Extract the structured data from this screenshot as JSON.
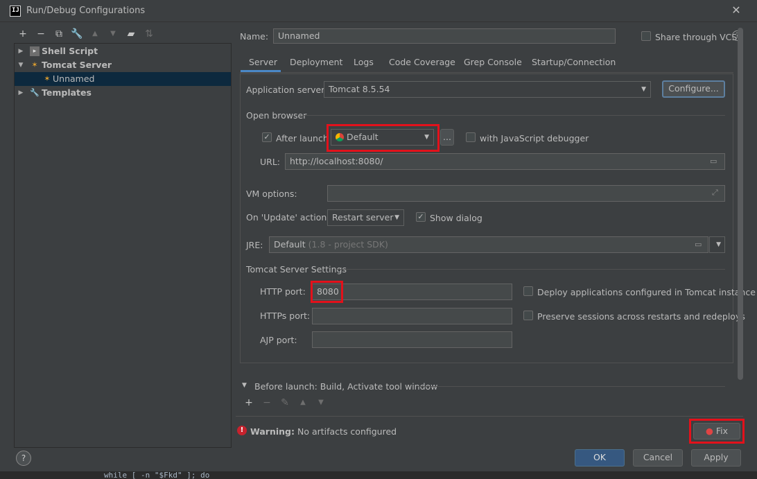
{
  "window": {
    "title": "Run/Debug Configurations",
    "app_icon_text": "IJ"
  },
  "toolbar": {
    "icons": [
      "add-icon",
      "remove-icon",
      "copy-icon",
      "wrench-icon",
      "move-up-icon",
      "move-down-icon",
      "folder-icon",
      "sort-icon"
    ]
  },
  "tree": {
    "items": [
      {
        "label": "Shell Script",
        "icon": "shell-script-icon",
        "expanded": false
      },
      {
        "label": "Tomcat Server",
        "icon": "tomcat-icon",
        "expanded": true
      },
      {
        "label": "Unnamed",
        "icon": "tomcat-config-icon",
        "selected": true
      },
      {
        "label": "Templates",
        "icon": "wrench-icon",
        "expanded": false
      }
    ]
  },
  "name_field": {
    "label": "Name:",
    "value": "Unnamed"
  },
  "share_vcs": {
    "label": "Share through VCS",
    "checked": false
  },
  "tabs": [
    "Server",
    "Deployment",
    "Logs",
    "Code Coverage",
    "Grep Console",
    "Startup/Connection"
  ],
  "server": {
    "app_server_label": "Application server:",
    "app_server_value": "Tomcat 8.5.54",
    "configure_label": "Configure...",
    "open_browser_label": "Open browser",
    "after_launch_label": "After launch",
    "browser_value": "Default",
    "ellipsis_label": "...",
    "js_debugger_label": "with JavaScript debugger",
    "url_label": "URL:",
    "url_value": "http://localhost:8080/",
    "vm_options_label": "VM options:",
    "on_update_label": "On 'Update' action:",
    "on_update_value": "Restart server",
    "show_dialog_label": "Show dialog",
    "jre_label": "JRE:",
    "jre_value": "Default",
    "jre_hint": "(1.8 - project SDK)",
    "tomcat_settings_label": "Tomcat Server Settings",
    "http_port_label": "HTTP port:",
    "http_port_value": "8080",
    "https_port_label": "HTTPs port:",
    "ajp_port_label": "AJP port:",
    "deploy_apps_label": "Deploy applications configured in Tomcat instance",
    "preserve_sessions_label": "Preserve sessions across restarts and redeploys"
  },
  "before_launch": {
    "label": "Before launch: Build, Activate tool window"
  },
  "warning": {
    "bold": "Warning:",
    "text": "No artifacts configured",
    "fix_label": "Fix"
  },
  "footer": {
    "ok": "OK",
    "cancel": "Cancel",
    "apply": "Apply",
    "help": "?"
  },
  "editor_peek": "while [ -n \"$Fkd\" ]; do",
  "colors": {
    "accent": "#4a88c7",
    "highlight_red": "#e3111b",
    "primary_button": "#365880",
    "selection": "#0d293e"
  }
}
